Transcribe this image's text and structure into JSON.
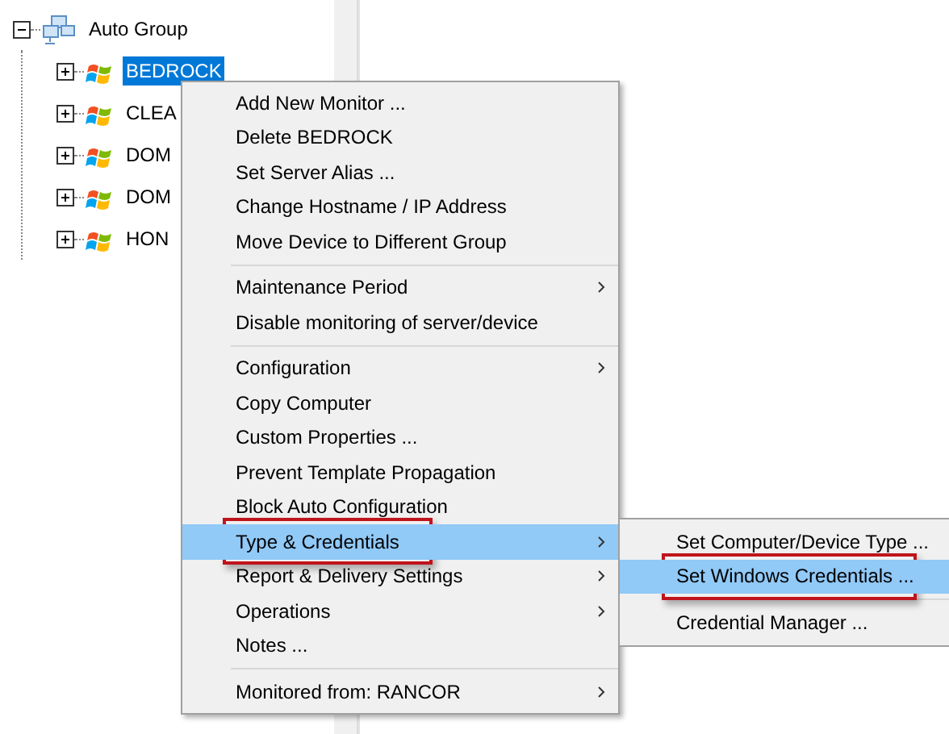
{
  "tree": {
    "label": "Auto Group",
    "expanded": true,
    "selected": false,
    "children": [
      {
        "label": "BEDROCK",
        "expanded": false,
        "selected": true
      },
      {
        "label": "CLEA",
        "expanded": false,
        "selected": false
      },
      {
        "label": "DOM",
        "expanded": false,
        "selected": false
      },
      {
        "label": "DOM",
        "expanded": false,
        "selected": false
      },
      {
        "label": "HON",
        "expanded": false,
        "selected": false
      }
    ]
  },
  "context_menu": {
    "items": [
      {
        "kind": "item",
        "label": "Add New Monitor ...",
        "has_submenu": false,
        "selected": false,
        "framed": false
      },
      {
        "kind": "item",
        "label": "Delete BEDROCK",
        "has_submenu": false,
        "selected": false,
        "framed": false
      },
      {
        "kind": "item",
        "label": "Set Server Alias ...",
        "has_submenu": false,
        "selected": false,
        "framed": false
      },
      {
        "kind": "item",
        "label": "Change Hostname / IP Address",
        "has_submenu": false,
        "selected": false,
        "framed": false
      },
      {
        "kind": "item",
        "label": "Move Device to Different Group",
        "has_submenu": false,
        "selected": false,
        "framed": false
      },
      {
        "kind": "separator"
      },
      {
        "kind": "item",
        "label": "Maintenance Period",
        "has_submenu": true,
        "selected": false,
        "framed": false
      },
      {
        "kind": "item",
        "label": "Disable monitoring of server/device",
        "has_submenu": false,
        "selected": false,
        "framed": false
      },
      {
        "kind": "separator"
      },
      {
        "kind": "item",
        "label": "Configuration",
        "has_submenu": true,
        "selected": false,
        "framed": false
      },
      {
        "kind": "item",
        "label": "Copy Computer",
        "has_submenu": false,
        "selected": false,
        "framed": false
      },
      {
        "kind": "item",
        "label": "Custom Properties ...",
        "has_submenu": false,
        "selected": false,
        "framed": false
      },
      {
        "kind": "item",
        "label": "Prevent Template Propagation",
        "has_submenu": false,
        "selected": false,
        "framed": false
      },
      {
        "kind": "item",
        "label": "Block Auto Configuration",
        "has_submenu": false,
        "selected": false,
        "framed": false
      },
      {
        "kind": "item",
        "label": "Type & Credentials",
        "has_submenu": true,
        "selected": true,
        "framed": true
      },
      {
        "kind": "item",
        "label": "Report & Delivery Settings",
        "has_submenu": true,
        "selected": false,
        "framed": false
      },
      {
        "kind": "item",
        "label": "Operations",
        "has_submenu": true,
        "selected": false,
        "framed": false
      },
      {
        "kind": "item",
        "label": "Notes ...",
        "has_submenu": false,
        "selected": false,
        "framed": false
      },
      {
        "kind": "separator"
      },
      {
        "kind": "item",
        "label": "Monitored from: RANCOR",
        "has_submenu": true,
        "selected": false,
        "framed": false
      }
    ]
  },
  "submenu": {
    "items": [
      {
        "kind": "item",
        "label": "Set Computer/Device Type ...",
        "selected": false,
        "framed": false
      },
      {
        "kind": "item",
        "label": "Set Windows Credentials ...",
        "selected": true,
        "framed": true
      },
      {
        "kind": "separator"
      },
      {
        "kind": "item",
        "label": "Credential Manager ...",
        "selected": false,
        "framed": false
      }
    ]
  }
}
